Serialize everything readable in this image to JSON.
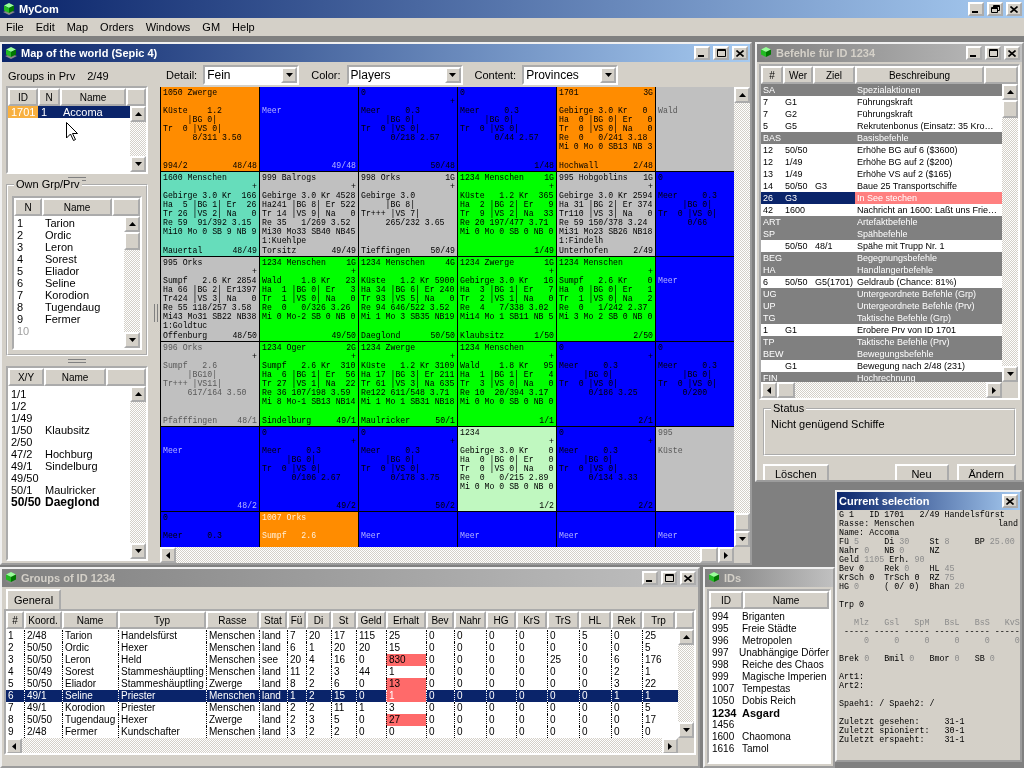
{
  "app": {
    "title": "MyCom"
  },
  "menu": [
    "File",
    "Edit",
    "Map",
    "Orders",
    "Windows",
    "GM",
    "Help"
  ],
  "map_window": {
    "title": "Map of the world (Sepic 4)",
    "active": true,
    "groups_label": "Groups in Prv",
    "groups_prv": "2/49",
    "groups_columns": [
      "ID",
      "N",
      "Name"
    ],
    "groups_rows": [
      {
        "id": "1701",
        "n": "1",
        "name": "Accoma",
        "selected": true
      }
    ],
    "own_title": "Own Grp/Prv",
    "own_columns": [
      "N",
      "Name"
    ],
    "own_rows": [
      {
        "n": "1",
        "name": "Tarion",
        "disabled": false
      },
      {
        "n": "2",
        "name": "Ordic",
        "disabled": false
      },
      {
        "n": "3",
        "name": "Leron",
        "disabled": false
      },
      {
        "n": "4",
        "name": "Sorest",
        "disabled": false
      },
      {
        "n": "5",
        "name": "Eliador",
        "disabled": false
      },
      {
        "n": "6",
        "name": "Seline",
        "disabled": false
      },
      {
        "n": "7",
        "name": "Korodion",
        "disabled": false
      },
      {
        "n": "8",
        "name": "Tugendaug",
        "disabled": false
      },
      {
        "n": "9",
        "name": "Fermer",
        "disabled": false
      },
      {
        "n": "10",
        "disabled": true
      }
    ],
    "prv_columns": [
      "X/Y",
      "Name"
    ],
    "prv_rows": [
      {
        "xy": "1/1",
        "bold": false
      },
      {
        "xy": "1/2",
        "bold": false
      },
      {
        "xy": "1/49",
        "bold": false
      },
      {
        "xy": "1/50",
        "name": "Klaubsitz",
        "bold": false
      },
      {
        "xy": "2/50",
        "bold": false
      },
      {
        "xy": "47/2",
        "name": "Hochburg",
        "bold": false
      },
      {
        "xy": "49/1",
        "name": "Sindelburg",
        "bold": false
      },
      {
        "xy": "49/50",
        "bold": false
      },
      {
        "xy": "50/1",
        "name": "Maulricker",
        "bold": false
      },
      {
        "xy": "50/50",
        "name": "Daeglond",
        "bold": true
      }
    ],
    "controls": [
      {
        "label": "Detail:",
        "value": "Fein"
      },
      {
        "label": "Color:",
        "value": "Players"
      },
      {
        "label": "Content:",
        "value": "Provinces"
      }
    ],
    "cells": [
      [
        {
          "color": "#ff8c00",
          "header": "1050 Zwerge",
          "lines": [
            "Küste    1.2",
            "     |BG 0|",
            "Tr  0 |VS 0|",
            "      8/311 3.50"
          ],
          "label": "994/2",
          "coord": "48/48",
          "faded": false
        },
        {
          "color": "#0000ff",
          "lines": [
            "Meer"
          ],
          "coord": "49/48",
          "faded": true
        },
        {
          "color": "#0000ff",
          "header": "0",
          "marker": "+",
          "lines": [
            "Meer     0.3",
            "     |BG 0|",
            "Tr  0 |VS 0|",
            "      0/218 2.57"
          ],
          "coord": "50/48",
          "faded": false
        },
        {
          "color": "#0000ff",
          "header": "0",
          "lines": [
            "Meer     0.3",
            "     |BG 0|",
            "Tr  0 |VS 0|",
            "       0/44 2.57"
          ],
          "coord": "1/48",
          "faded": false
        },
        {
          "color": "#ff8c00",
          "header": "1701",
          "corner": "3G",
          "lines": [
            "Gebirge 3.0 Kr   0",
            "Ha  0 |BG 0| Er   0",
            "Tr  0 |VS 0| Na   0",
            "Re  0   0/241 3.18",
            "Mi 0 Mo 0 SB13 NB 3"
          ],
          "label": "Hochwall",
          "coord": "2/48",
          "faded": false
        },
        {
          "color": "#c0c0c0",
          "lines": [
            "Wald"
          ],
          "faded": true
        }
      ],
      [
        {
          "color": "#66ddbb",
          "header": "1600 Menschen",
          "marker": "+",
          "lines": [
            "Gebirge 3.0 Kr  166",
            "Ha  5 |BG 1| Er  26",
            "Tr 26 |VS 2| Na   0",
            "Re 59  91/392 3.15",
            "Mi10 Mo 0 SB 9 NB 9"
          ],
          "label": "Mauertal",
          "coord": "48/49",
          "faded": false
        },
        {
          "color": "#c0c0c0",
          "header": "999 Balrogs",
          "marker": "+",
          "lines": [
            "Gebirge 3.0 Kr 4528",
            "Ha241 |BG 8| Er 522",
            "Tr 14 |VS 9| Na   0",
            "Re 35   1/269 3.52",
            "Mi30 Mo33 SB40 NB45",
            "1:Kuehlpe"
          ],
          "label": "Torsitz",
          "coord": "49/49",
          "faded": false
        },
        {
          "color": "#c0c0c0",
          "header": "998 Orks",
          "corner": "1G",
          "marker": "+",
          "lines": [
            "Gebirge 3.0",
            "     |BG 8|",
            "Tr+++ |VS 7|",
            "     265/232 3.65"
          ],
          "label": "Tieffingen",
          "coord": "50/49",
          "faded": false
        },
        {
          "color": "#00ff00",
          "header": "1234 Menschen",
          "corner": "1G",
          "marker": "+",
          "lines": [
            "Küste   1.2 Kr  365",
            "Ha  2 |BG 2| Er   9",
            "Tr  9 |VS 2| Na  33",
            "Re 20 197/477 3.71",
            "Mi 0 Mo 0 SB 0 NB 0"
          ],
          "coord": "1/49",
          "faded": false
        },
        {
          "color": "#c0c0c0",
          "header": "995 Hobgoblins",
          "corner": "1G",
          "marker": "+",
          "lines": [
            "Gebirge 3.0 Kr 2594",
            "Ha 31 |BG 2| Er 374",
            "Tr110 |VS 3| Na   0",
            "Re 59 150/378 3.24",
            "Mi31 Mo23 SB26 NB18",
            "1:Findelh"
          ],
          "label": "Unterhofen",
          "coord": "2/49",
          "faded": false
        },
        {
          "color": "#0000ff",
          "header": "0",
          "lines": [
            "Meer     0.3",
            "     |BG 0|",
            "Tr  0 |VS 0|",
            "      0/66"
          ],
          "faded": false
        }
      ],
      [
        {
          "color": "#c0c0c0",
          "header": "995 Orks",
          "marker": "+",
          "lines": [
            "Sumpf   2.6 Kr 2854",
            "Ha 66 |BG 2| Er1397",
            "Tr424 |VS 3| Na   0",
            "Re 55 118/257 3.58",
            "Mi43 Mo31 SB22 NB38",
            "1:Goldtuc"
          ],
          "label": "Offenburg",
          "coord": "48/50",
          "faded": false
        },
        {
          "color": "#00ff00",
          "header": "1234 Menschen",
          "corner": "1G",
          "marker": "+",
          "lines": [
            "Wald    1.8 Kr   23",
            "Ha  1 |BG 0| Er   3",
            "Tr  1 |VS 0| Na   0",
            "Re  0   0/326 3.26",
            "Mi 0 Mo-2 SB 0 NB 0"
          ],
          "coord": "49/50",
          "faded": false
        },
        {
          "color": "#00ff00",
          "header": "1234 Menschen",
          "corner": "4G",
          "lines": [
            "Küste   1.2 Kr 5900",
            "Ha 34 |BG 6| Er 240",
            "Tr 93 |VS 5| Na   0",
            "Re 94 646/522 3.52",
            "Mi 1 Mo 3 SB35 NB19"
          ],
          "label": "Daeglond",
          "coord": "50/50",
          "faded": false
        },
        {
          "color": "#00ff00",
          "header": "1234 Zwerge",
          "corner": "1G",
          "marker": "+",
          "lines": [
            "Gebirge 3.0 Kr   16",
            "Ha  3 |BG 1| Er   7",
            "Tr  2 |VS 1| Na   0",
            "Re  4   7/338 3.02",
            "Mi14 Mo 1 SB11 NB 5"
          ],
          "label": "Klaubsitz",
          "coord": "1/50",
          "faded": false
        },
        {
          "color": "#00ff00",
          "header": "1234 Menschen",
          "marker": "+",
          "lines": [
            "Sumpf   2.6 Kr    0",
            "Ha  0 |BG 0| Er   1",
            "Tr  1 |VS 0| Na   2",
            "Re  0   1/242 2.37",
            "Mi 3 Mo 2 SB 0 NB 0"
          ],
          "coord": "2/50",
          "faded": false
        },
        {
          "color": "#0000ff",
          "lines": [
            "Meer"
          ],
          "faded": true
        }
      ],
      [
        {
          "color": "#c0c0c0",
          "header": "996 Orks",
          "marker": "+",
          "lines": [
            "Sumpf   2.6",
            "     |BG10|",
            "Tr+++ |VS11|",
            "     617/164 3.50"
          ],
          "label": "Pfafffingen",
          "coord": "48/1",
          "faded": true
        },
        {
          "color": "#00ff00",
          "header": "1234 Oger",
          "corner": "2G",
          "marker": "+",
          "lines": [
            "Sumpf   2.6 Kr  310",
            "Ha  6 |BG 1| Er  56",
            "Tr 27 |VS 1| Na  22",
            "Re 36 107/198 3.59",
            "Mi 8 Mo-1 SB13 NB14"
          ],
          "label": "Sindelburg",
          "coord": "49/1",
          "faded": false
        },
        {
          "color": "#00ff00",
          "header": "1234 Zwerge",
          "marker": "+",
          "lines": [
            "Küste   1.2 Kr 3109",
            "Ha 17 |BG 3| Er 211",
            "Tr 61 |VS 3| Na 635",
            "Re122 611/548 3.71",
            "Mi 1 Mo 1 SB31 NB18"
          ],
          "label": "Maulricker",
          "coord": "50/1",
          "faded": false
        },
        {
          "color": "#00ff00",
          "header": "1234 Menschen",
          "marker": "+",
          "lines": [
            "Wald    1.8 Kr   95",
            "Ha  1 |BG 1| Er   4",
            "Tr  3 |VS 0| Na   0",
            "Re 10  20/394 3.17",
            "Mi 0 Mo 0 SB 0 NB 0"
          ],
          "coord": "1/1",
          "faded": false
        },
        {
          "color": "#0000ff",
          "header": "0",
          "marker": "+",
          "lines": [
            "Meer     0.3",
            "     |BG 0|",
            "Tr  0 |VS 0|",
            "      0/186 3.25"
          ],
          "coord": "2/1",
          "faded": false
        },
        {
          "color": "#0000ff",
          "header": "0",
          "lines": [
            "Meer     0.3",
            "     |BG 0|",
            "Tr  0 |VS 0|",
            "     0/200"
          ],
          "faded": false
        }
      ],
      [
        {
          "color": "#0000ff",
          "lines": [
            "Meer"
          ],
          "coord": "48/2",
          "faded": true
        },
        {
          "color": "#0000ff",
          "header": "0",
          "marker": "+",
          "lines": [
            "Meer     0.3",
            "     |BG 0|",
            "Tr  0 |VS 0|",
            "      0/106 2.67"
          ],
          "coord": "49/2",
          "faded": false
        },
        {
          "color": "#0000ff",
          "header": "0",
          "marker": "+",
          "lines": [
            "Meer     0.3",
            "     |BG 0|",
            "Tr  0 |VS 0|",
            "      0/178 3.75"
          ],
          "coord": "50/2",
          "faded": false
        },
        {
          "color": "#c0f8c0",
          "header": "1234",
          "marker": "+",
          "lines": [
            "Gebirge 3.0 Kr    0",
            "Ha  0 |BG 0| Er   0",
            "Tr  0 |VS 0| Na   0",
            "Re  0   0/215 2.89",
            "Mi 0 Mo 0 SB 0 NB 0"
          ],
          "coord": "1/2",
          "faded": false
        },
        {
          "color": "#0000ff",
          "header": "0",
          "marker": "+",
          "lines": [
            "Meer     0.3",
            "     |BG 0|",
            "Tr  0 |VS 0|",
            "      0/134 3.33"
          ],
          "coord": "2/2",
          "faded": false
        },
        {
          "color": "#c0c0c0",
          "header": "995",
          "lines": [
            "Küste"
          ],
          "faded": true
        }
      ],
      [
        {
          "color": "#0000ff",
          "header": "0",
          "lines": [
            "Meer     0.3"
          ],
          "faded": false
        },
        {
          "color": "#ff8c00",
          "header": "1007 Orks",
          "lines": [
            "Sumpf   2.6"
          ],
          "faded": true
        },
        {
          "color": "#0000ff",
          "lines": [
            "Meer"
          ],
          "faded": true
        },
        {
          "color": "#0000ff",
          "lines": [
            "Meer"
          ],
          "faded": true
        },
        {
          "color": "#0000ff",
          "lines": [
            "Meer"
          ],
          "faded": true
        },
        {
          "color": "#0000ff",
          "lines": [
            "Meer"
          ],
          "faded": true
        }
      ]
    ]
  },
  "orders_window": {
    "title": "Befehle für ID 1234",
    "active": false,
    "columns": [
      "#",
      "Wer",
      "Ziel",
      "Beschreibung"
    ],
    "rows": [
      {
        "kind": "section",
        "num": "SA",
        "desc": "Spezialaktionen"
      },
      {
        "kind": "order",
        "num": "7",
        "who": "G1",
        "desc": "Führungskraft",
        "selected": false,
        "error": false
      },
      {
        "kind": "order",
        "num": "7",
        "who": "G2",
        "desc": "Führungskraft",
        "selected": false,
        "error": false
      },
      {
        "kind": "order",
        "num": "5",
        "who": "G5",
        "desc": "Rekrutenbonus (Einsatz: 35 Kro…",
        "selected": false,
        "error": false
      },
      {
        "kind": "section",
        "num": "BAS",
        "desc": "Basisbefehle"
      },
      {
        "kind": "order",
        "num": "12",
        "who": "50/50",
        "desc": "Erhöhe BG auf 6 ($3600)",
        "selected": false,
        "error": false
      },
      {
        "kind": "order",
        "num": "12",
        "who": "1/49",
        "desc": "Erhöhe BG auf 2 ($200)",
        "selected": false,
        "error": false
      },
      {
        "kind": "order",
        "num": "13",
        "who": "1/49",
        "desc": "Erhöhe VS auf 2 ($165)",
        "selected": false,
        "error": false
      },
      {
        "kind": "order",
        "num": "14",
        "who": "50/50",
        "target": "G3",
        "desc": "Baue 25 Transportschiffe",
        "selected": false,
        "error": false
      },
      {
        "kind": "order",
        "num": "26",
        "who": "G3",
        "desc": "In See stechen",
        "selected": true,
        "error": true
      },
      {
        "kind": "order",
        "num": "42",
        "who": "1600",
        "desc": "Nachricht an 1600: Laßt uns Frie…",
        "selected": false,
        "error": false
      },
      {
        "kind": "section",
        "num": "ART",
        "desc": "Artefaktbefehle"
      },
      {
        "kind": "section",
        "num": "SP",
        "desc": "Spähbefehle"
      },
      {
        "kind": "order",
        "who": "50/50",
        "target": "48/1",
        "desc": "Spähe mit Trupp Nr. 1",
        "selected": false,
        "error": false
      },
      {
        "kind": "section",
        "num": "BEG",
        "desc": "Begegnungsbefehle"
      },
      {
        "kind": "section",
        "num": "HA",
        "desc": "Handlangerbefehle"
      },
      {
        "kind": "order",
        "num": "6",
        "who": "50/50",
        "target": "G5(1701)",
        "desc": "Geldraub (Chance: 81%)",
        "selected": false,
        "error": false
      },
      {
        "kind": "section",
        "num": "UG",
        "desc": "Untergeordnete Befehle (Grp)"
      },
      {
        "kind": "section",
        "num": "UP",
        "desc": "Untergeordnete Befehle (Prv)"
      },
      {
        "kind": "section",
        "num": "TG",
        "desc": "Taktische Befehle (Grp)"
      },
      {
        "kind": "order",
        "num": "1",
        "who": "G1",
        "desc": "Erobere Prv von ID 1701",
        "selected": false,
        "error": false
      },
      {
        "kind": "section",
        "num": "TP",
        "desc": "Taktische Befehle (Prv)"
      },
      {
        "kind": "section",
        "num": "BEW",
        "desc": "Bewegungsbefehle"
      },
      {
        "kind": "order",
        "who": "G1",
        "desc": "Bewegung nach 2/48 (231)",
        "selected": false,
        "error": false
      },
      {
        "kind": "section",
        "num": "FIN",
        "desc": "Hochrechnung"
      }
    ],
    "status_title": "Status",
    "status": "Nicht genügend Schiffe",
    "buttons": [
      "Löschen",
      "Neu",
      "Ändern"
    ]
  },
  "groups_window": {
    "title": "Groups of ID 1234",
    "active": false,
    "tabs": [
      {
        "label": "General",
        "selected": true
      }
    ],
    "columns": [
      "#",
      "Koord.",
      "Name",
      "Typ",
      "Rasse",
      "Stat",
      "Fü",
      "Di",
      "St",
      "Geld",
      "Erhalt",
      "Bev",
      "Nahr",
      "HG",
      "KrS",
      "TrS",
      "HL",
      "Rek",
      "Trp"
    ],
    "rows": [
      {
        "cells": [
          "1",
          "2/48",
          "Tarion",
          "Handelsfürst",
          "Menschen",
          "land",
          "7",
          "20",
          "17",
          "115",
          "25",
          "0",
          "0",
          "0",
          "0",
          "0",
          "5",
          "0",
          "25"
        ],
        "selected": false,
        "warn": false
      },
      {
        "cells": [
          "2",
          "50/50",
          "Ordic",
          "Hexer",
          "Menschen",
          "land",
          "6",
          "1",
          "20",
          "20",
          "15",
          "0",
          "0",
          "0",
          "0",
          "0",
          "0",
          "0",
          "5"
        ],
        "selected": false,
        "warn": false
      },
      {
        "cells": [
          "3",
          "50/50",
          "Leron",
          "Held",
          "Menschen",
          "see",
          "20",
          "4",
          "16",
          "0",
          "830",
          "0",
          "0",
          "0",
          "0",
          "25",
          "0",
          "6",
          "176"
        ],
        "selected": false,
        "warn": true
      },
      {
        "cells": [
          "4",
          "50/49",
          "Sorest",
          "Stammeshäuptling",
          "Menschen",
          "land",
          "11",
          "2",
          "3",
          "44",
          "1",
          "0",
          "0",
          "0",
          "0",
          "0",
          "0",
          "2",
          "1"
        ],
        "selected": false,
        "warn": false
      },
      {
        "cells": [
          "5",
          "50/50",
          "Eliador",
          "Stammeshäuptling",
          "Zwerge",
          "land",
          "8",
          "2",
          "6",
          "0",
          "13",
          "0",
          "0",
          "0",
          "0",
          "0",
          "0",
          "3",
          "22"
        ],
        "selected": false,
        "warn": true
      },
      {
        "cells": [
          "6",
          "49/1",
          "Seline",
          "Priester",
          "Menschen",
          "land",
          "1",
          "2",
          "15",
          "0",
          "1",
          "0",
          "0",
          "0",
          "0",
          "0",
          "0",
          "1",
          "1"
        ],
        "selected": true,
        "warn": true
      },
      {
        "cells": [
          "7",
          "49/1",
          "Korodion",
          "Priester",
          "Menschen",
          "land",
          "2",
          "2",
          "11",
          "1",
          "3",
          "0",
          "0",
          "0",
          "0",
          "0",
          "0",
          "0",
          "5"
        ],
        "selected": false,
        "warn": false
      },
      {
        "cells": [
          "8",
          "50/50",
          "Tugendaug",
          "Hexer",
          "Zwerge",
          "land",
          "2",
          "3",
          "5",
          "0",
          "27",
          "0",
          "0",
          "0",
          "0",
          "0",
          "0",
          "0",
          "17"
        ],
        "selected": false,
        "warn": true
      },
      {
        "cells": [
          "9",
          "2/48",
          "Fermer",
          "Kundschafter",
          "Menschen",
          "land",
          "3",
          "2",
          "2",
          "0",
          "0",
          "0",
          "0",
          "0",
          "0",
          "0",
          "0",
          "0",
          "0"
        ],
        "selected": false,
        "warn": false
      }
    ]
  },
  "ids_window": {
    "title": "IDs",
    "active": false,
    "columns": [
      "ID",
      "Name"
    ],
    "rows": [
      {
        "id": "994",
        "name": "Briganten",
        "current": false
      },
      {
        "id": "995",
        "name": "Freie Städte",
        "current": false
      },
      {
        "id": "996",
        "name": "Metropolen",
        "current": false
      },
      {
        "id": "997",
        "name": "Unabhängige Dörfer",
        "current": false
      },
      {
        "id": "998",
        "name": "Reiche des Chaos",
        "current": false
      },
      {
        "id": "999",
        "name": "Magische Imperien",
        "current": false
      },
      {
        "id": "1007",
        "name": "Tempestas",
        "current": false
      },
      {
        "id": "1050",
        "name": "Dobis Reich",
        "current": false
      },
      {
        "id": "1234",
        "name": "Asgard",
        "current": true
      },
      {
        "id": "1456",
        "current": false
      },
      {
        "id": "1600",
        "name": "Chaomona",
        "current": false
      },
      {
        "id": "1616",
        "name": "Tamol",
        "current": false
      }
    ]
  },
  "selection_panel": {
    "title": "Current selection",
    "active": true,
    "lines": [
      {
        "kind": "fields",
        "fields": [
          {
            "label": "G 1   ID 1701   2/49 Handelsfürst"
          }
        ]
      },
      {
        "kind": "fields",
        "fields": [
          {
            "label": "Rasse: Menschen"
          }
        ],
        "right": "land"
      },
      {
        "kind": "fields",
        "fields": [
          {
            "label": "Name: Accoma"
          }
        ]
      },
      {
        "kind": "fields",
        "fields": [
          {
            "label": "Fü",
            "value": "5",
            "muted": true
          },
          {
            "label": "Di",
            "value": "30",
            "muted": true
          },
          {
            "label": "St",
            "value": "8",
            "muted": true
          },
          {
            "label": "BP",
            "value": "25.00",
            "muted": true
          }
        ]
      },
      {
        "kind": "fields",
        "fields": [
          {
            "label": "Nahr",
            "value": "0",
            "muted": true
          },
          {
            "label": "NB",
            "value": "0",
            "muted": true
          },
          {
            "label": "NZ"
          }
        ]
      },
      {
        "kind": "fields",
        "fields": [
          {
            "label": "Geld",
            "value": "1105",
            "muted": true
          },
          {
            "label": "Erh.",
            "value": "90",
            "muted": true
          }
        ]
      },
      {
        "kind": "fields",
        "fields": [
          {
            "label": "Bev",
            "value": "0",
            "muted": false
          },
          {
            "label": "Rek",
            "value": "0",
            "muted": true
          },
          {
            "label": "HL",
            "value": "45",
            "muted": true
          }
        ]
      },
      {
        "kind": "fields",
        "fields": [
          {
            "label": "KrSch",
            "value": "0",
            "muted": false
          },
          {
            "label": "TrSch",
            "value": "0",
            "muted": false
          },
          {
            "label": "RZ",
            "value": "75",
            "muted": true
          }
        ]
      },
      {
        "kind": "fields",
        "fields": [
          {
            "label": "HG",
            "value": "0",
            "muted": true
          },
          {
            "label": "( 0/ 0)"
          },
          {
            "label": "Bhan",
            "value": "20",
            "muted": true
          }
        ]
      },
      {
        "kind": "blank"
      },
      {
        "kind": "fields",
        "fields": [
          {
            "label": "Trp",
            "value": "0",
            "muted": false
          }
        ]
      },
      {
        "kind": "blank"
      },
      {
        "kind": "columns",
        "fields": [
          {
            "label": "Mlz",
            "muted": true
          },
          {
            "label": "Gsl",
            "muted": true
          },
          {
            "label": "SpM",
            "muted": true
          },
          {
            "label": "BsL",
            "muted": true
          },
          {
            "label": "BsS",
            "muted": true
          },
          {
            "label": "KvS",
            "muted": true
          }
        ]
      },
      {
        "kind": "columns",
        "fields": [
          {
            "label": "-----"
          },
          {
            "label": "-----"
          },
          {
            "label": "-----"
          },
          {
            "label": "-----"
          },
          {
            "label": "-----"
          },
          {
            "label": "-----"
          }
        ]
      },
      {
        "kind": "columns",
        "fields": [
          {
            "label": "0",
            "muted": true
          },
          {
            "label": "0",
            "muted": true
          },
          {
            "label": "0",
            "muted": true
          },
          {
            "label": "0",
            "muted": true
          },
          {
            "label": "0",
            "muted": true
          },
          {
            "label": "0",
            "muted": true
          }
        ]
      },
      {
        "kind": "blank"
      },
      {
        "kind": "fields",
        "fields": [
          {
            "label": "Brek",
            "value": "0",
            "muted": true
          },
          {
            "label": "Bmil",
            "value": "0",
            "muted": true
          },
          {
            "label": "Bmor",
            "value": "0",
            "muted": true
          },
          {
            "label": "SB",
            "value": "0",
            "muted": true
          }
        ]
      },
      {
        "kind": "blank"
      },
      {
        "kind": "fields",
        "fields": [
          {
            "label": "Art1:"
          }
        ]
      },
      {
        "kind": "fields",
        "fields": [
          {
            "label": "Art2:"
          }
        ]
      },
      {
        "kind": "blank"
      },
      {
        "kind": "fields",
        "fields": [
          {
            "label": "Spaeh1:",
            "value": "/",
            "muted": false
          },
          {
            "label": "Spaeh2:",
            "value": "/",
            "muted": false
          }
        ]
      },
      {
        "kind": "blank"
      },
      {
        "kind": "pairs",
        "fields": [
          {
            "label": "Zuletzt gesehen:",
            "value": "31-1",
            "muted": false
          }
        ]
      },
      {
        "kind": "pairs",
        "fields": [
          {
            "label": "Zuletzt spioniert:",
            "value": "30-1",
            "muted": false
          }
        ]
      },
      {
        "kind": "pairs",
        "fields": [
          {
            "label": "Zuletzt erspaeht:",
            "value": "31-1",
            "muted": false
          }
        ]
      }
    ]
  }
}
